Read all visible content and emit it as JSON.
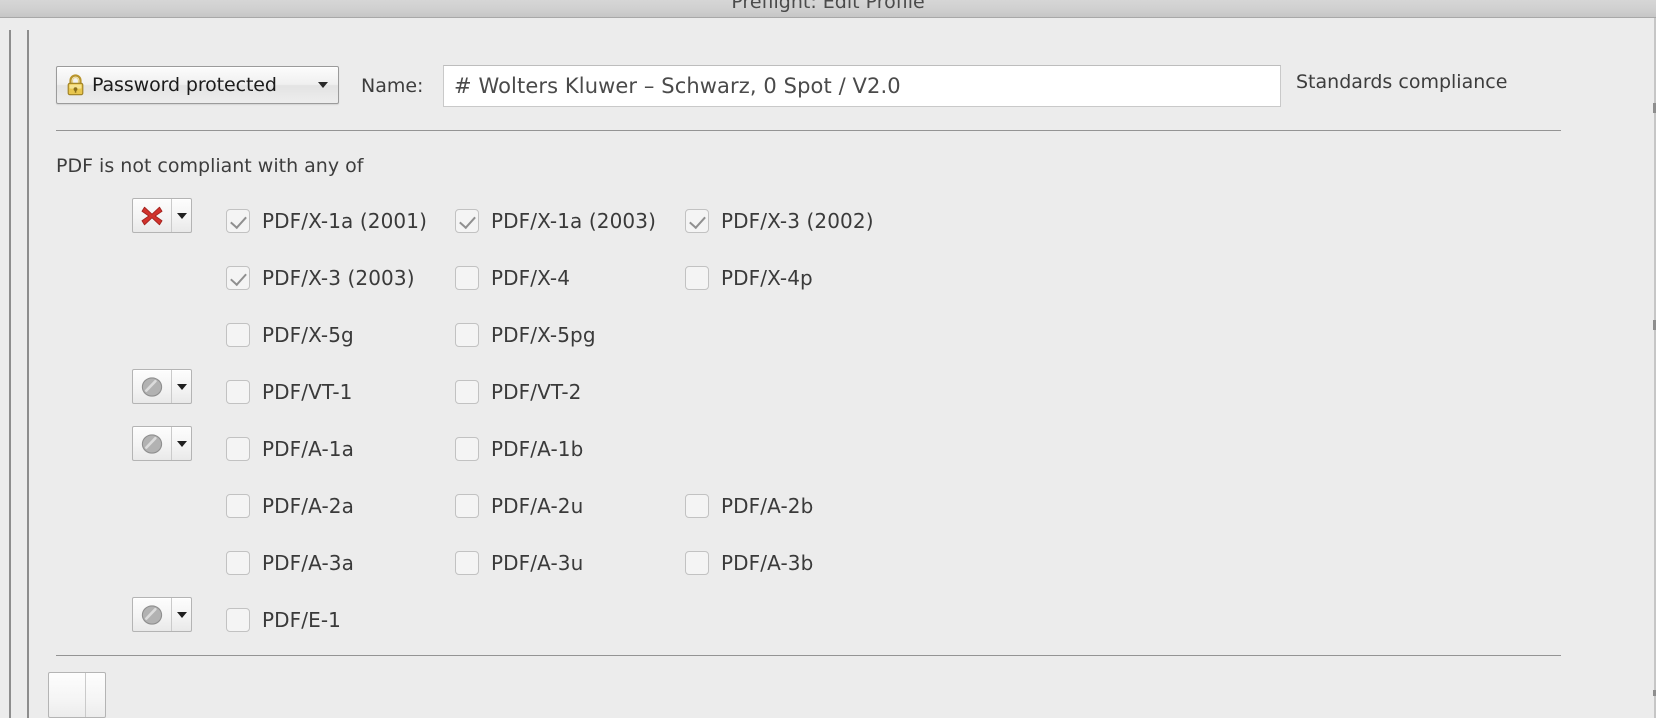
{
  "window": {
    "title": "Preflight: Edit Profile"
  },
  "header": {
    "security_combo": {
      "icon": "lock-icon",
      "label": "Password protected",
      "arrow_icon": "chevron-down-icon"
    },
    "name_label": "Name:",
    "name_value": "# Wolters Kluwer – Schwarz, 0 Spot / V2.0",
    "standards_label": "Standards compliance"
  },
  "section": {
    "caption": "PDF is not compliant with any of"
  },
  "colors": {
    "background": "#ececec",
    "error_red": "#d1322c",
    "neutral_grey": "#a8a8a8",
    "text": "#3a3a3a",
    "divider": "#949494"
  },
  "rows": [
    {
      "status": {
        "icon": "red-x-icon",
        "kind": "error",
        "arrow_icon": "chevron-down-icon"
      },
      "items": [
        {
          "label": "PDF/X-1a (2001)",
          "checked": true
        },
        {
          "label": "PDF/X-1a (2003)",
          "checked": true
        },
        {
          "label": "PDF/X-3 (2002)",
          "checked": true
        }
      ]
    },
    {
      "status": null,
      "items": [
        {
          "label": "PDF/X-3 (2003)",
          "checked": true
        },
        {
          "label": "PDF/X-4",
          "checked": false
        },
        {
          "label": "PDF/X-4p",
          "checked": false
        }
      ]
    },
    {
      "status": null,
      "items": [
        {
          "label": "PDF/X-5g",
          "checked": false
        },
        {
          "label": "PDF/X-5pg",
          "checked": false
        }
      ]
    },
    {
      "status": {
        "icon": "grey-circle-icon",
        "kind": "neutral",
        "arrow_icon": "chevron-down-icon"
      },
      "items": [
        {
          "label": "PDF/VT-1",
          "checked": false
        },
        {
          "label": "PDF/VT-2",
          "checked": false
        }
      ]
    },
    {
      "status": {
        "icon": "grey-circle-icon",
        "kind": "neutral",
        "arrow_icon": "chevron-down-icon"
      },
      "items": [
        {
          "label": "PDF/A-1a",
          "checked": false
        },
        {
          "label": "PDF/A-1b",
          "checked": false
        }
      ]
    },
    {
      "status": null,
      "items": [
        {
          "label": "PDF/A-2a",
          "checked": false
        },
        {
          "label": "PDF/A-2u",
          "checked": false
        },
        {
          "label": "PDF/A-2b",
          "checked": false
        }
      ]
    },
    {
      "status": null,
      "items": [
        {
          "label": "PDF/A-3a",
          "checked": false
        },
        {
          "label": "PDF/A-3u",
          "checked": false
        },
        {
          "label": "PDF/A-3b",
          "checked": false
        }
      ]
    },
    {
      "status": {
        "icon": "grey-circle-icon",
        "kind": "neutral",
        "arrow_icon": "chevron-down-icon"
      },
      "items": [
        {
          "label": "PDF/E-1",
          "checked": false
        }
      ]
    }
  ]
}
